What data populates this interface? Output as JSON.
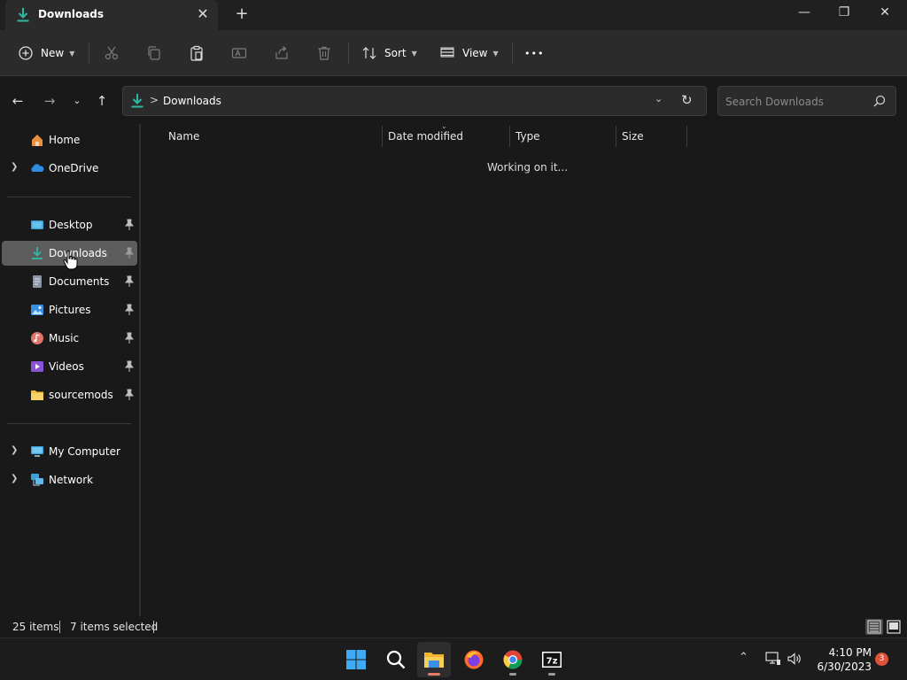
{
  "window": {
    "tab_title": "Downloads",
    "tab_close": "✕",
    "new_tab": "+",
    "minimize": "—",
    "maximize": "❐",
    "close": "✕"
  },
  "toolbar": {
    "new_label": "New",
    "sort_label": "Sort",
    "view_label": "View",
    "more_label": "•••"
  },
  "address": {
    "path": "Downloads",
    "separator": ">",
    "search_placeholder": "Search Downloads"
  },
  "sidebar": {
    "items": [
      {
        "label": "Home",
        "icon": "home-icon"
      },
      {
        "label": "OneDrive",
        "icon": "cloud-icon",
        "expandable": true
      },
      {
        "label": "Desktop",
        "icon": "desktop-icon",
        "pinned": true
      },
      {
        "label": "Downloads",
        "icon": "download-icon",
        "pinned": true,
        "selected": true
      },
      {
        "label": "Documents",
        "icon": "document-icon",
        "pinned": true
      },
      {
        "label": "Pictures",
        "icon": "pictures-icon",
        "pinned": true
      },
      {
        "label": "Music",
        "icon": "music-icon",
        "pinned": true
      },
      {
        "label": "Videos",
        "icon": "videos-icon",
        "pinned": true
      },
      {
        "label": "sourcemods",
        "icon": "folder-icon",
        "pinned": true
      },
      {
        "label": "My Computer",
        "icon": "computer-icon",
        "expandable": true
      },
      {
        "label": "Network",
        "icon": "network-icon",
        "expandable": true
      }
    ]
  },
  "columns": [
    "Name",
    "Date modified",
    "Type",
    "Size"
  ],
  "content": {
    "loading_text": "Working on it..."
  },
  "status": {
    "item_count": "25 items",
    "selected_count": "7 items selected"
  },
  "taskbar": {
    "time": "4:10 PM",
    "date": "6/30/2023",
    "notification_count": "3",
    "apps": [
      "start",
      "search",
      "file-explorer",
      "firefox",
      "chrome",
      "7zip"
    ],
    "sevenzip_label": "7z"
  },
  "colors": {
    "accent": "#2fb8a6",
    "selected_bg": "#5d5d5d",
    "notification": "#e0513c"
  }
}
